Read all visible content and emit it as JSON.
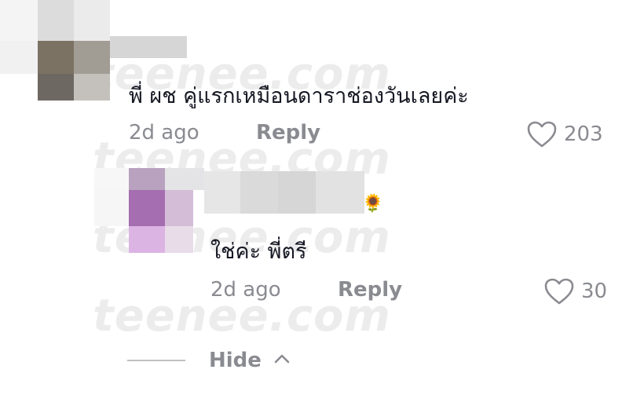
{
  "watermark": {
    "text": "teenee.com"
  },
  "comment": {
    "text": "พี่ ผช คู่แรกเหมือนดาราช่องวันเลยค่ะ",
    "time": "2d ago",
    "reply_label": "Reply",
    "like_count": "203"
  },
  "reply": {
    "emoji": "🌻",
    "text": "ใช่ค่ะ พี่ตรี",
    "time": "2d ago",
    "reply_label": "Reply",
    "like_count": "30"
  },
  "thread": {
    "hide_label": "Hide"
  },
  "icons": {
    "like": "heart-outline-icon",
    "hide": "chevron-up-icon"
  },
  "colors": {
    "text_primary": "#161823",
    "text_secondary": "#8a8b91",
    "watermark": "#ececec"
  }
}
